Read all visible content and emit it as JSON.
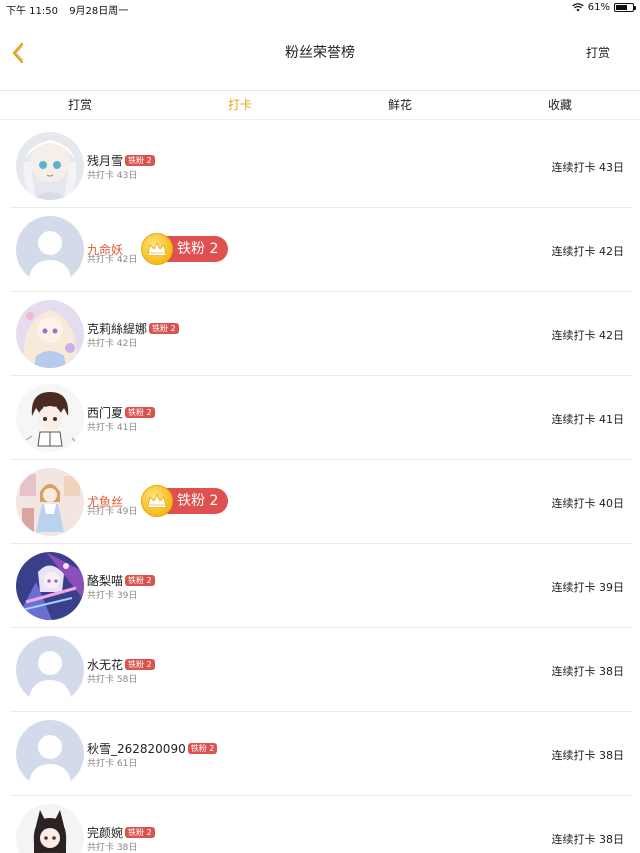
{
  "status": {
    "time": "下午 11:50",
    "date": "9月28日周一",
    "battery": "61%"
  },
  "nav": {
    "title": "粉丝荣誉榜",
    "action": "打赏"
  },
  "tabs": [
    {
      "label": "打赏"
    },
    {
      "label": "打卡",
      "active": true
    },
    {
      "label": "鲜花"
    },
    {
      "label": "收藏"
    }
  ],
  "fans": [
    {
      "name": "残月雪",
      "badge": "铁粉 2",
      "total": "共打卡 43日",
      "streak": "连续打卡 43日"
    },
    {
      "name": "九命妖",
      "badge": "铁粉 2",
      "total": "共打卡 42日",
      "streak": "连续打卡 42日"
    },
    {
      "name": "克莉絲緹娜",
      "badge": "铁粉 2",
      "total": "共打卡 42日",
      "streak": "连续打卡 42日"
    },
    {
      "name": "西门夏",
      "badge": "铁粉 2",
      "total": "共打卡 41日",
      "streak": "连续打卡 41日"
    },
    {
      "name": "尤鱼丝",
      "badge": "铁粉 2",
      "total": "共打卡 49日",
      "streak": "连续打卡 40日"
    },
    {
      "name": "酪梨喵",
      "badge": "铁粉 2",
      "total": "共打卡 39日",
      "streak": "连续打卡 39日"
    },
    {
      "name": "水无花",
      "badge": "铁粉 2",
      "total": "共打卡 58日",
      "streak": "连续打卡 38日"
    },
    {
      "name": "秋雪_262820090",
      "badge": "铁粉 2",
      "total": "共打卡 61日",
      "streak": "连续打卡 38日"
    },
    {
      "name": "完颜婉",
      "badge": "铁粉 2",
      "total": "共打卡 38日",
      "streak": "连续打卡 38日"
    }
  ]
}
